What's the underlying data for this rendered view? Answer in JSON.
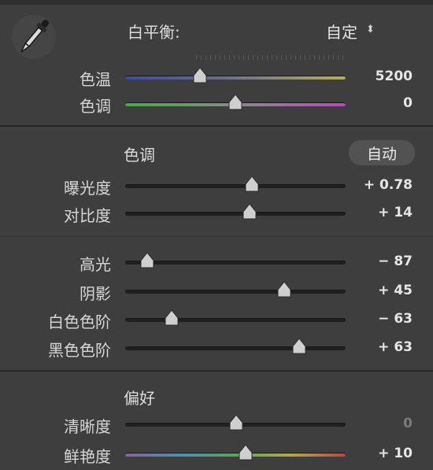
{
  "white_balance": {
    "label": "白平衡:",
    "value": "自定",
    "dropdown_glyph": "⬍"
  },
  "tone_section": {
    "title": "色调",
    "auto_label": "自动"
  },
  "presence_section": {
    "title": "偏好"
  },
  "sliders": {
    "temp": {
      "label": "色温",
      "value": "5200",
      "fraction": 0.34,
      "track": "temp"
    },
    "tint": {
      "label": "色调",
      "value": "0",
      "fraction": 0.5,
      "track": "tint"
    },
    "exposure": {
      "label": "曝光度",
      "value": "+ 0.78",
      "fraction": 0.575,
      "track": "dark"
    },
    "contrast": {
      "label": "对比度",
      "value": "+ 14",
      "fraction": 0.565,
      "track": "dark"
    },
    "highlights": {
      "label": "高光",
      "value": "− 87",
      "fraction": 0.1,
      "track": "dark"
    },
    "shadows": {
      "label": "阴影",
      "value": "+ 45",
      "fraction": 0.72,
      "track": "dark"
    },
    "whites": {
      "label": "白色色阶",
      "value": "− 63",
      "fraction": 0.21,
      "track": "dark"
    },
    "blacks": {
      "label": "黑色色阶",
      "value": "+ 63",
      "fraction": 0.79,
      "track": "dark"
    },
    "clarity": {
      "label": "清晰度",
      "value": "0",
      "fraction": 0.505,
      "track": "dark",
      "dim_value": true
    },
    "vibrance": {
      "label": "鲜艳度",
      "value": "+ 10",
      "fraction": 0.545,
      "track": "vib"
    }
  },
  "icons": {
    "eyedropper": "eyedropper-icon",
    "thumb": "slider-thumb-icon"
  }
}
